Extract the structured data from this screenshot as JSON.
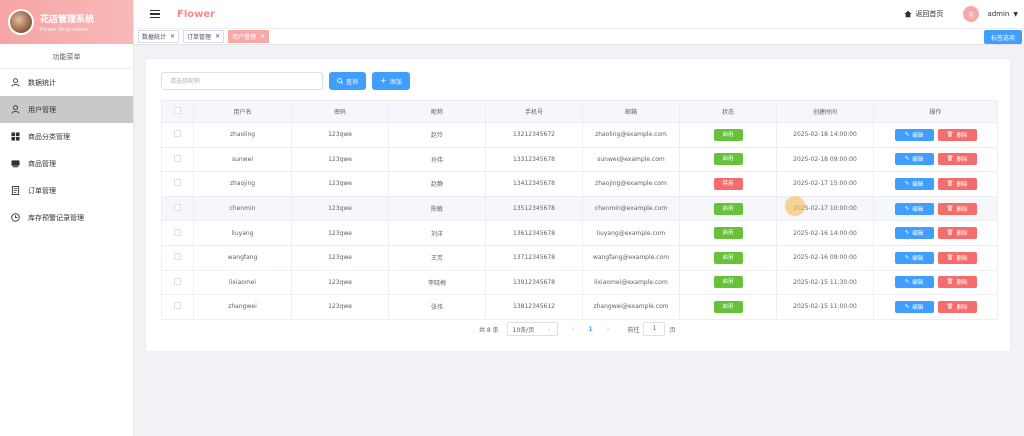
{
  "app": {
    "title": "花店管理系统",
    "subtitle": "Flower Shop Admin",
    "brand": "Flower"
  },
  "sidebar": {
    "caption": "功能菜单",
    "items": [
      {
        "label": "数据统计",
        "icon": "chart-icon"
      },
      {
        "label": "用户管理",
        "icon": "user-icon",
        "active": true
      },
      {
        "label": "商品分类管理",
        "icon": "category-icon"
      },
      {
        "label": "商品管理",
        "icon": "goods-icon"
      },
      {
        "label": "订单管理",
        "icon": "order-icon"
      },
      {
        "label": "库存预警记录管理",
        "icon": "clock-icon"
      }
    ]
  },
  "header": {
    "home": "返回首页",
    "avatar_text": "花",
    "user": "admin"
  },
  "tags": {
    "items": [
      "数据统计",
      "订单管理",
      "用户管理"
    ],
    "active_index": 2,
    "options": "标签选项"
  },
  "toolbar": {
    "search_placeholder": "请选择昵称",
    "query_label": "查询",
    "add_label": "添加"
  },
  "table": {
    "columns": [
      "用户名",
      "密码",
      "昵称",
      "手机号",
      "邮箱",
      "状态",
      "创建时间",
      "操作"
    ],
    "edit_label": "编辑",
    "delete_label": "删除",
    "rows": [
      {
        "username": "zhaoling",
        "password": "123qwe",
        "nickname": "赵玲",
        "phone": "13212345672",
        "email": "zhaoling@example.com",
        "status": "启用",
        "created": "2025-02-18 14:00:00"
      },
      {
        "username": "sunwei",
        "password": "123qwe",
        "nickname": "孙伟",
        "phone": "13312345678",
        "email": "sunwei@example.com",
        "status": "启用",
        "created": "2025-02-18 09:00:00"
      },
      {
        "username": "zhaojing",
        "password": "123qwe",
        "nickname": "赵静",
        "phone": "13412345678",
        "email": "zhaojing@example.com",
        "status": "禁用",
        "created": "2025-02-17 15:00:00"
      },
      {
        "username": "chenmin",
        "password": "123qwe",
        "nickname": "陈敏",
        "phone": "13512345678",
        "email": "chenmin@example.com",
        "status": "启用",
        "created": "2025-02-17 10:00:00"
      },
      {
        "username": "liuyang",
        "password": "123qwe",
        "nickname": "刘洋",
        "phone": "13612345678",
        "email": "liuyang@example.com",
        "status": "启用",
        "created": "2025-02-16 14:00:00"
      },
      {
        "username": "wangfang",
        "password": "123qwe",
        "nickname": "王芳",
        "phone": "13712345678",
        "email": "wangfang@example.com",
        "status": "启用",
        "created": "2025-02-16 09:00:00"
      },
      {
        "username": "lixiaomei",
        "password": "123qwe",
        "nickname": "李晓梅",
        "phone": "13912345678",
        "email": "lixiaomei@example.com",
        "status": "启用",
        "created": "2025-02-15 11:30:00"
      },
      {
        "username": "zhangwei",
        "password": "123qwe",
        "nickname": "张伟",
        "phone": "13812345612",
        "email": "zhangwei@example.com",
        "status": "启用",
        "created": "2025-02-15 11:00:00"
      }
    ]
  },
  "pagination": {
    "total": "共 8 条",
    "page_size": "10条/页",
    "current": "1",
    "goto": "前往",
    "goto_value": "1",
    "page_unit": "页"
  },
  "colors": {
    "accent": "#f7a8a8",
    "primary": "#409eff",
    "success": "#67c23a",
    "danger": "#f56c6c"
  }
}
